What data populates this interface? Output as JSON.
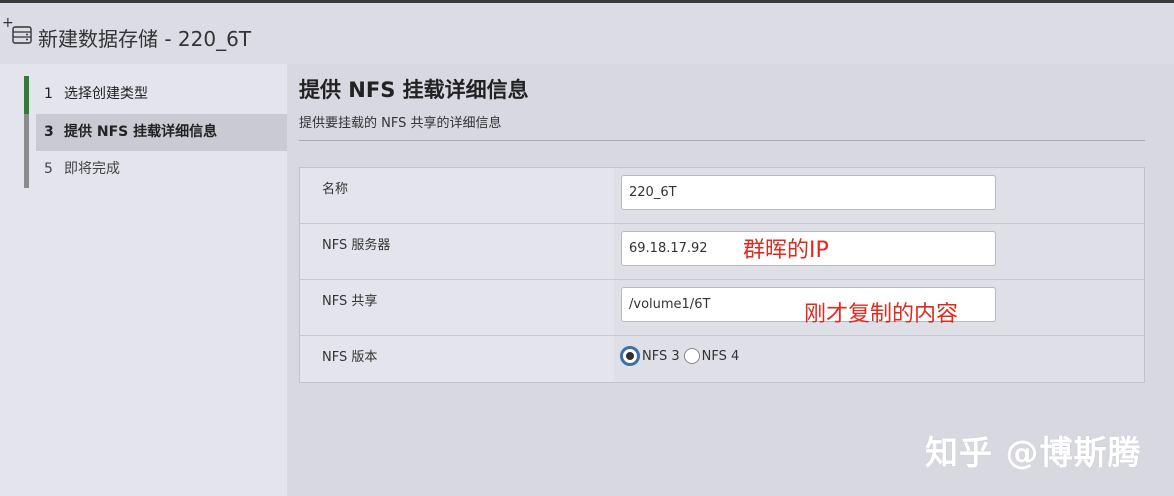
{
  "window": {
    "title": "新建数据存储 - 220_6T"
  },
  "nav": {
    "items": [
      {
        "num": "1",
        "label": "选择创建类型"
      },
      {
        "num": "3",
        "label": "提供 NFS 挂载详细信息"
      },
      {
        "num": "5",
        "label": "即将完成"
      }
    ]
  },
  "main": {
    "title": "提供 NFS 挂载详细信息",
    "subtitle": "提供要挂载的 NFS 共享的详细信息",
    "form": {
      "name_label": "名称",
      "name_value": "220_6T",
      "server_label": "NFS 服务器",
      "server_value": "69.18.17.92",
      "share_label": "NFS 共享",
      "share_value": "/volume1/6T",
      "version_label": "NFS 版本",
      "version_options": [
        "NFS 3",
        "NFS 4"
      ],
      "version_selected": "NFS 3"
    }
  },
  "annotations": {
    "server_note": "群晖的IP",
    "share_note": "刚才复制的内容"
  },
  "watermark": "知乎 @博斯腾",
  "colors": {
    "active_step": "#2e7d32",
    "annotation": "#e02a1e",
    "radio_selected": "#3e6fa8"
  }
}
